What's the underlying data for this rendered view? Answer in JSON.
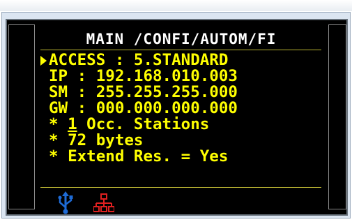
{
  "screen": {
    "title": "MAIN /CONFI/AUTOM/FI",
    "lines": [
      {
        "text": "ACCESS : 5.STANDARD"
      },
      {
        "text": "IP : 192.168.010.003"
      },
      {
        "text": "SM : 255.255.255.000"
      },
      {
        "text": "GW : 000.000.000.000"
      },
      {
        "prefix": "* ",
        "underlined": "1",
        "rest": " Occ. Stations"
      },
      {
        "text": "* 72 bytes"
      },
      {
        "text": "* Extend Res. = Yes"
      }
    ]
  },
  "colors": {
    "screen_bg": "#000000",
    "text": "#ffff00",
    "title": "#ffffff",
    "usb_icon": "#1e6bd6",
    "network_icon": "#e02020"
  },
  "icons": {
    "usb": "usb-icon",
    "network": "network-icon",
    "selection_cursor": "triangle-right-icon"
  }
}
